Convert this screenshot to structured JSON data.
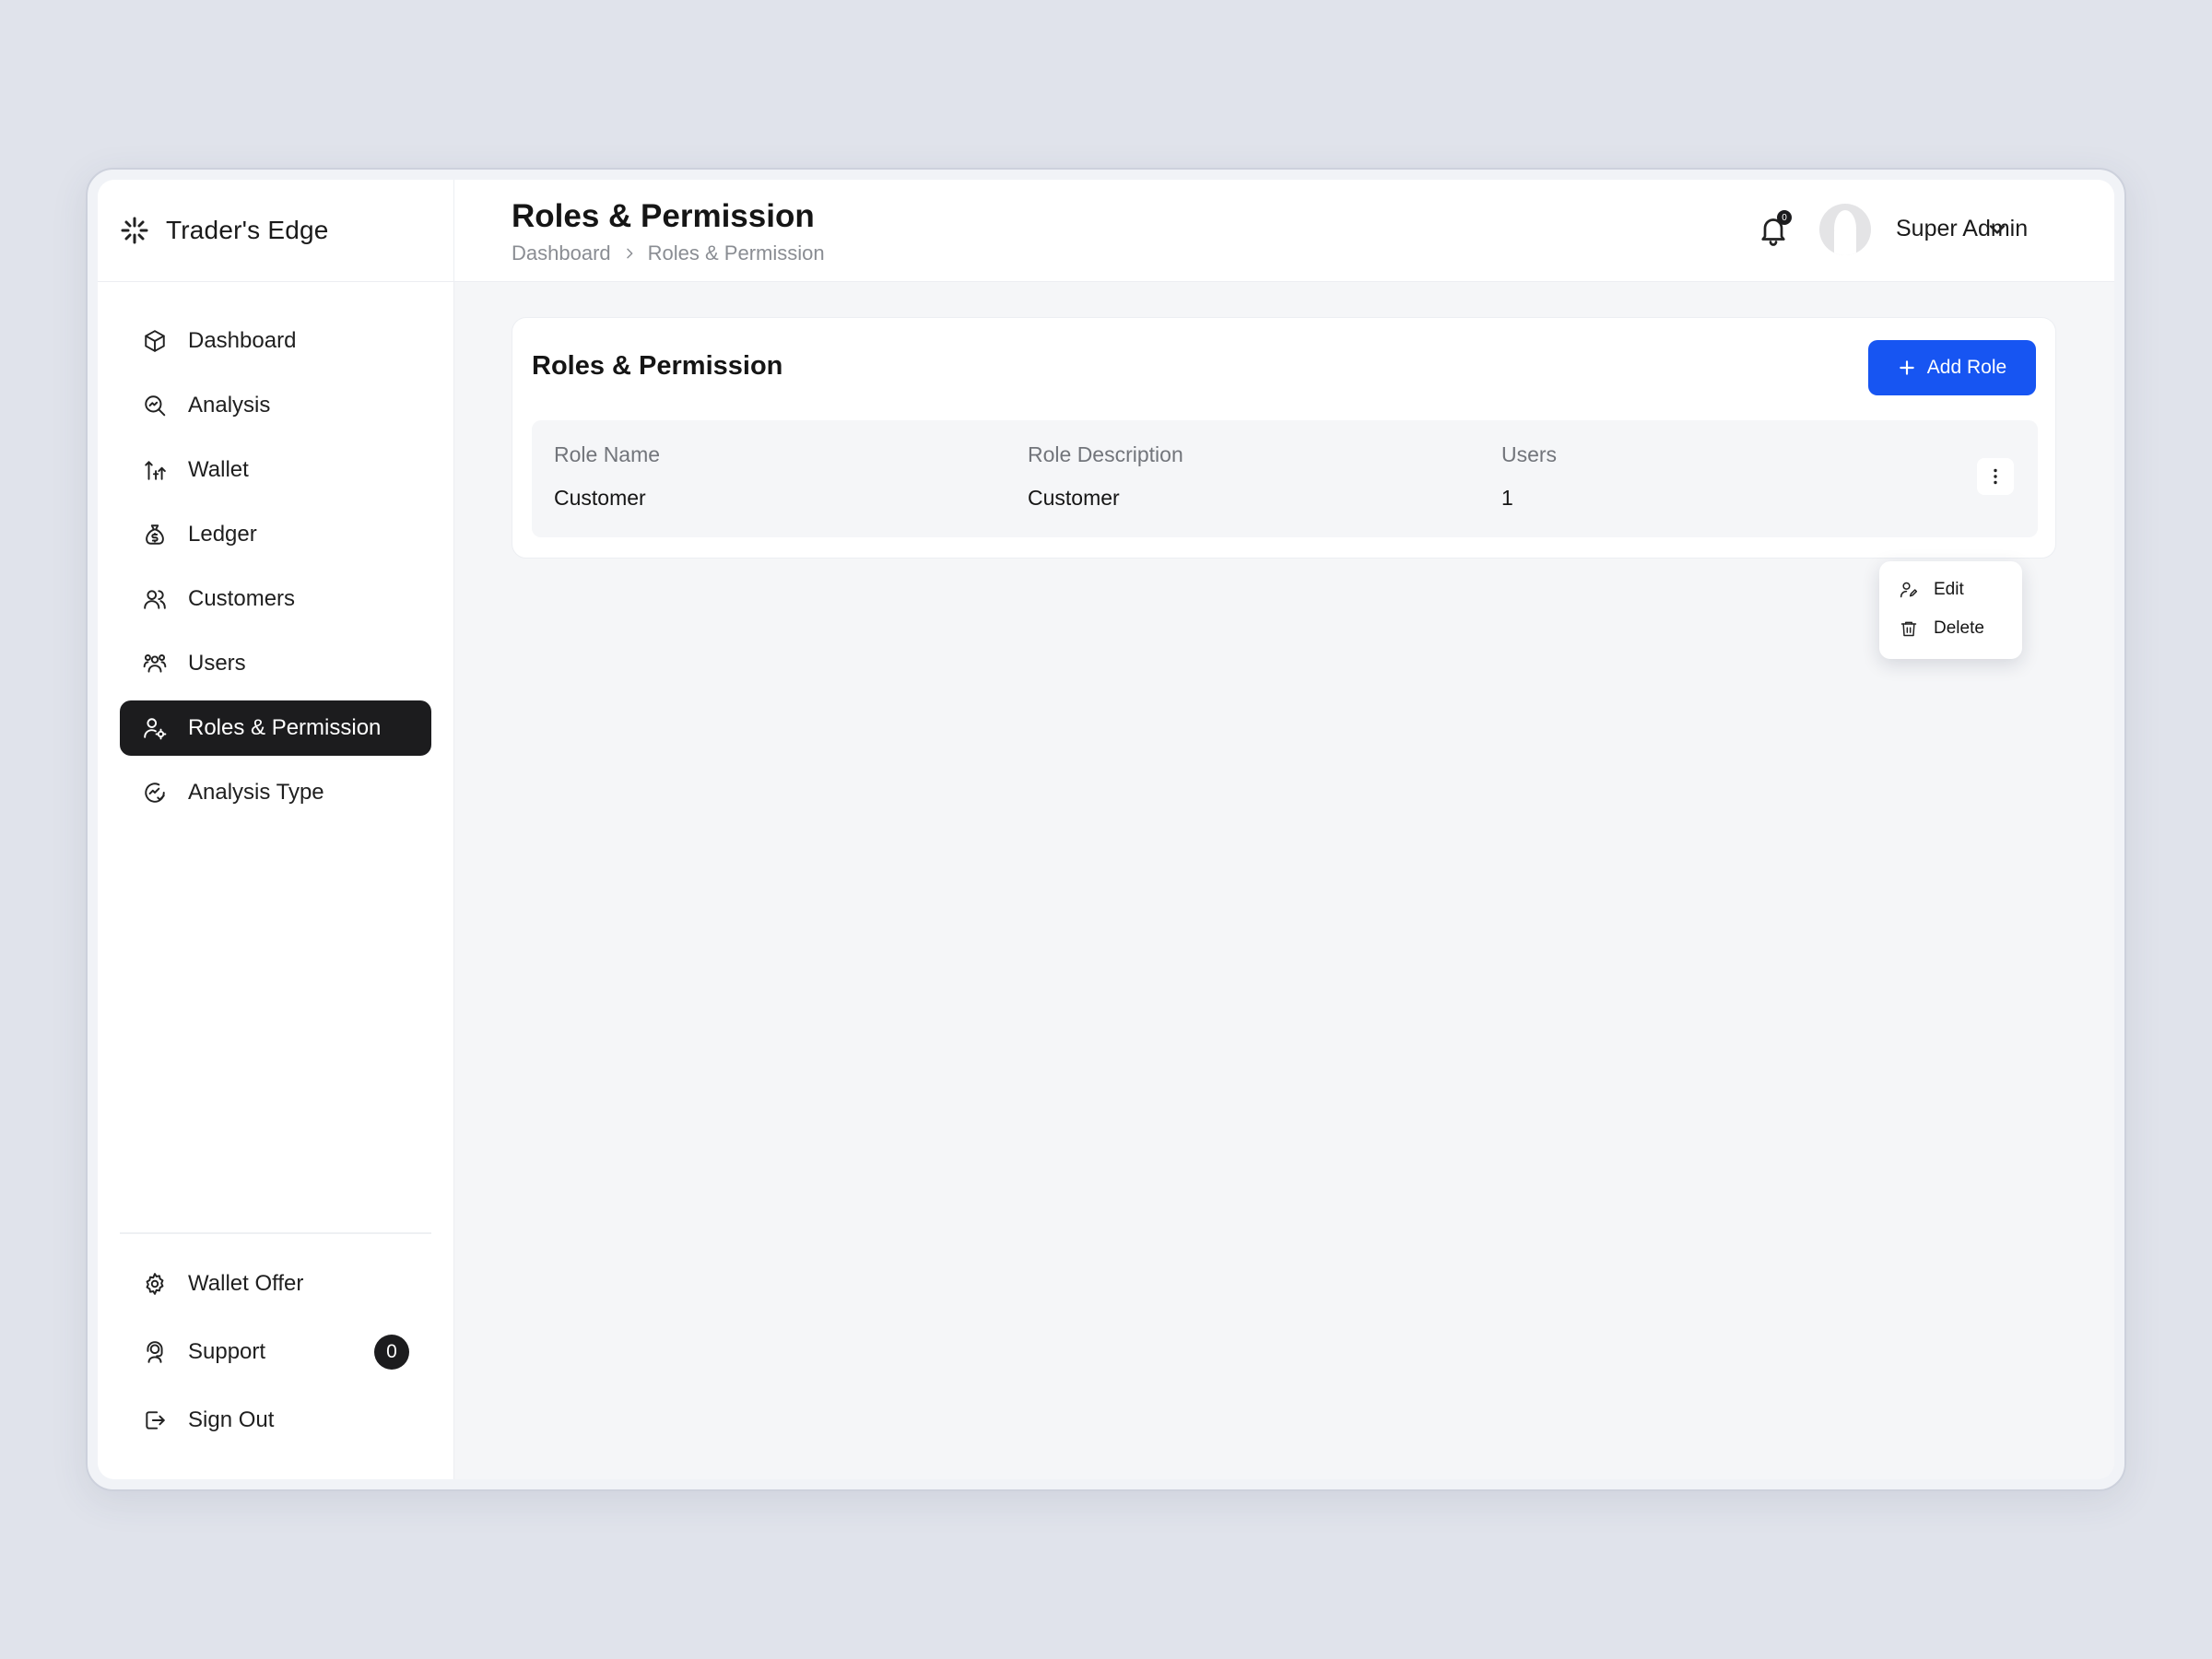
{
  "brand": {
    "name": "Trader's Edge"
  },
  "sidebar": {
    "items": [
      {
        "label": "Dashboard"
      },
      {
        "label": "Analysis"
      },
      {
        "label": "Wallet"
      },
      {
        "label": "Ledger"
      },
      {
        "label": "Customers"
      },
      {
        "label": "Users"
      },
      {
        "label": "Roles & Permission"
      },
      {
        "label": "Analysis Type"
      }
    ],
    "bottom": [
      {
        "label": "Wallet Offer"
      },
      {
        "label": "Support",
        "badge": "0"
      },
      {
        "label": "Sign Out"
      }
    ]
  },
  "header": {
    "title": "Roles & Permission",
    "breadcrumb": [
      "Dashboard",
      "Roles & Permission"
    ],
    "notification_count": "0",
    "user_name": "Super Admin"
  },
  "card": {
    "title": "Roles & Permission",
    "add_button": "Add Role",
    "columns": [
      "Role Name",
      "Role Description",
      "Users"
    ],
    "rows": [
      {
        "role_name": "Customer",
        "role_description": "Customer",
        "users": "1"
      }
    ]
  },
  "row_menu": {
    "items": [
      "Edit",
      "Delete"
    ]
  },
  "colors": {
    "accent": "#1755f2",
    "active_nav": "#1c1c1e"
  }
}
